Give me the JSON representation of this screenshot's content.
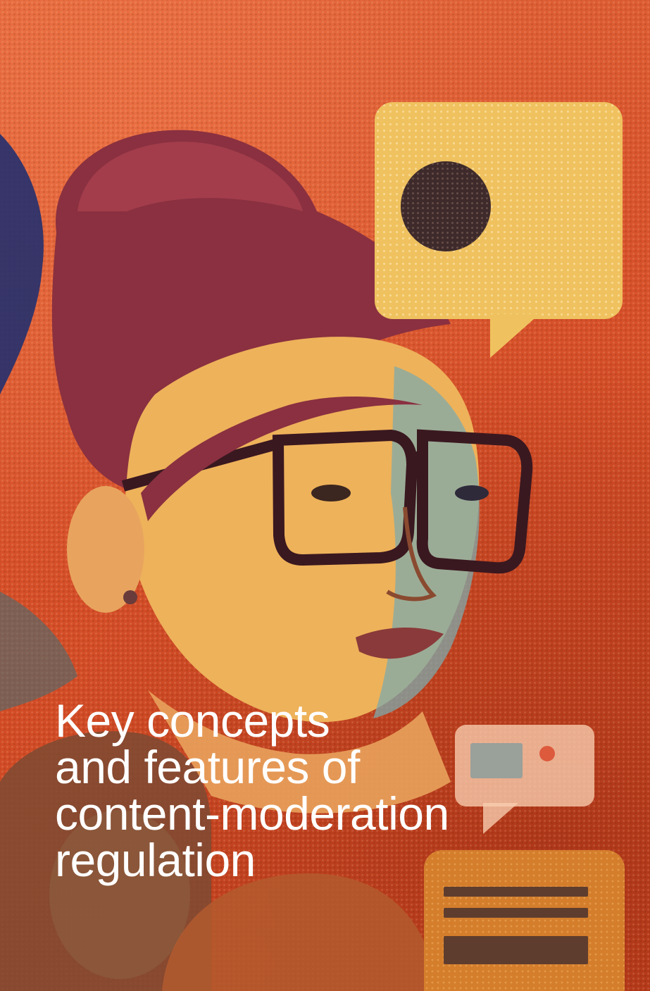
{
  "title": {
    "lines": [
      "Key concepts",
      "and features of",
      "content-moderation",
      "regulation"
    ]
  },
  "colors": {
    "background": "#d8532c",
    "speech_bubble": "#f0c25f",
    "title_text": "#ffffff"
  },
  "icons": [
    "speech-bubble-icon",
    "chat-bubble-icon",
    "message-card-icon"
  ]
}
